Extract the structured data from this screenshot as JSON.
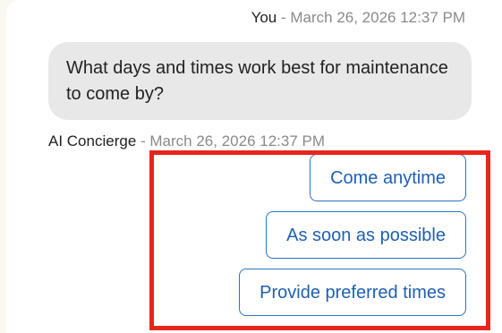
{
  "messages": {
    "user": {
      "sender": "You",
      "separator": " - ",
      "timestamp": "March 26, 2026 12:37 PM",
      "text": "What days and times work best for maintenance to come by?"
    },
    "assistant": {
      "sender": "AI Concierge",
      "separator": " - ",
      "timestamp": "March 26, 2026 12:37 PM"
    }
  },
  "quick_replies": [
    {
      "label": "Come anytime"
    },
    {
      "label": "As soon as possible"
    },
    {
      "label": "Provide preferred times"
    }
  ],
  "colors": {
    "page_background": "#fbf8ef",
    "panel_background": "#ffffff",
    "bubble_background": "#e8e8e8",
    "button_border": "#2a73c3",
    "button_text": "#1f5fb2",
    "highlight_box": "#e8251c"
  }
}
